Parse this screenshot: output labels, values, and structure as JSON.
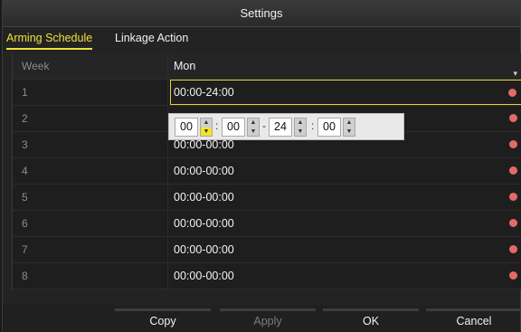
{
  "title": "Settings",
  "tabs": [
    {
      "label": "Arming Schedule"
    },
    {
      "label": "Linkage Action"
    }
  ],
  "week": {
    "label": "Week",
    "value": "Mon"
  },
  "rows": [
    {
      "index": "1",
      "time": "00:00-24:00"
    },
    {
      "index": "2",
      "time": ""
    },
    {
      "index": "3",
      "time": "00:00-00:00"
    },
    {
      "index": "4",
      "time": "00:00-00:00"
    },
    {
      "index": "5",
      "time": "00:00-00:00"
    },
    {
      "index": "6",
      "time": "00:00-00:00"
    },
    {
      "index": "7",
      "time": "00:00-00:00"
    },
    {
      "index": "8",
      "time": "00:00-00:00"
    }
  ],
  "editor": {
    "start_hour": "00",
    "start_min": "00",
    "dash": "-",
    "end_hour": "24",
    "end_min": "00",
    "colon": ":"
  },
  "buttons": {
    "copy": "Copy",
    "apply": "Apply",
    "ok": "OK",
    "cancel": "Cancel"
  },
  "colors": {
    "accent": "#f0e03a",
    "clock": "#e46a6a",
    "background": "#232323"
  }
}
